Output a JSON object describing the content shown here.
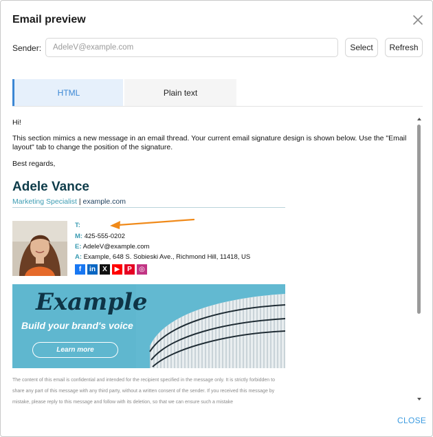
{
  "dialog": {
    "title": "Email preview",
    "close_label": "CLOSE"
  },
  "sender": {
    "label": "Sender:",
    "placeholder": "AdeleV@example.com",
    "select_label": "Select",
    "refresh_label": "Refresh"
  },
  "tabs": [
    {
      "label": "HTML",
      "active": true
    },
    {
      "label": "Plain text",
      "active": false
    }
  ],
  "message": {
    "greeting": "Hi!",
    "body": "This section mimics a new message in an email thread. Your current email signature design is shown below. Use the \"Email layout\" tab to change the position of the signature.",
    "closing": "Best regards,"
  },
  "signature": {
    "name": "Adele Vance",
    "role": "Marketing Specialist",
    "separator": "|",
    "website": "example.com",
    "contacts": {
      "t_key": "T:",
      "t_value": "",
      "m_key": "M:",
      "m_value": "425-555-0202",
      "e_key": "E:",
      "e_value": "AdeleV@example.com",
      "a_key": "A:",
      "a_value": "Example, 648 S. Sobieski Ave., Richmond Hill, 11418, US"
    },
    "socials": [
      {
        "icon": "facebook-icon",
        "glyph": "f",
        "color": "#1877f2"
      },
      {
        "icon": "linkedin-icon",
        "glyph": "in",
        "color": "#0a66c2"
      },
      {
        "icon": "x-icon",
        "glyph": "X",
        "color": "#111111"
      },
      {
        "icon": "youtube-icon",
        "glyph": "▶",
        "color": "#ff0000"
      },
      {
        "icon": "pinterest-icon",
        "glyph": "P",
        "color": "#e60023"
      },
      {
        "icon": "instagram-icon",
        "glyph": "◎",
        "color": "#c13584"
      }
    ]
  },
  "banner": {
    "logo": "Example",
    "tagline": "Build your brand's voice",
    "button": "Learn more"
  },
  "disclaimer": "The content of this email is confidential and intended for the recipient specified in the message only. It is strictly forbidden to share any part of this message with any third party, without a written consent of the sender. If you received this message by mistake, please reply to this message and follow with its deletion, so that we can ensure such a mistake",
  "colors": {
    "accent": "#3b87d4",
    "signature_name": "#0e3c4a",
    "signature_accent": "#3a9bb2",
    "arrow": "#f08a1a"
  }
}
